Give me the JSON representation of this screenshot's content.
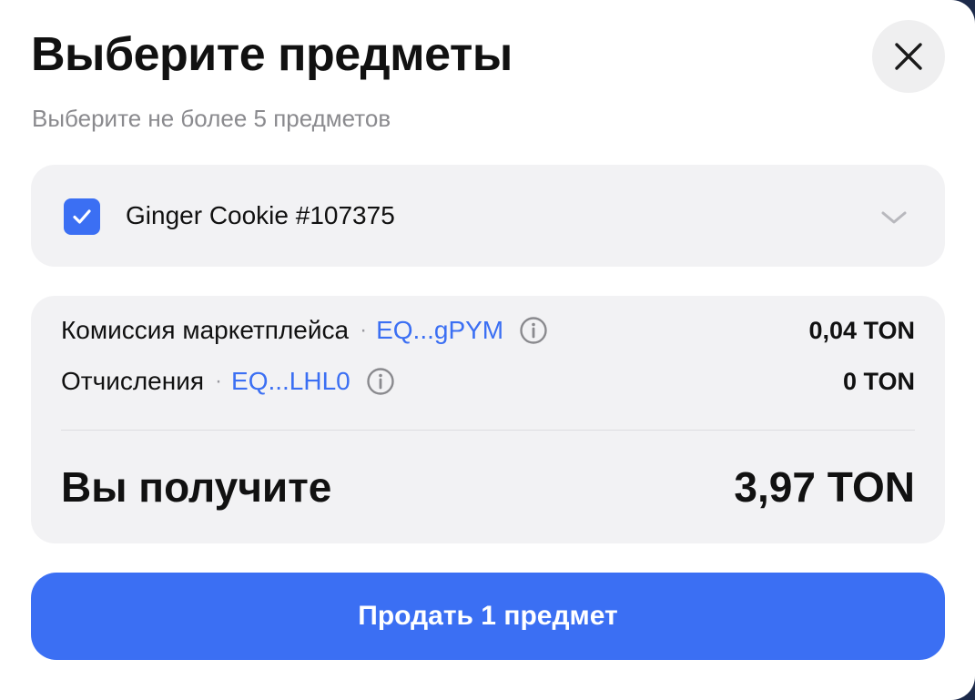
{
  "dialog": {
    "title": "Выберите предметы",
    "subtitle": "Выберите не более 5 предметов",
    "close_icon": "close-icon"
  },
  "item": {
    "checked": true,
    "name": "Ginger Cookie #107375",
    "expand_icon": "chevron-down-icon"
  },
  "fees": [
    {
      "label": "Комиссия маркетплейса",
      "address": "EQ...gPYM",
      "value": "0,04 TON"
    },
    {
      "label": "Отчисления",
      "address": "EQ...LHL0",
      "value": "0 TON"
    }
  ],
  "total": {
    "label": "Вы получите",
    "value": "3,97 TON"
  },
  "action": {
    "label": "Продать 1 предмет"
  },
  "colors": {
    "accent": "#3b6ff3",
    "card_bg": "#f2f2f4",
    "muted_text": "#8a8a8e"
  }
}
